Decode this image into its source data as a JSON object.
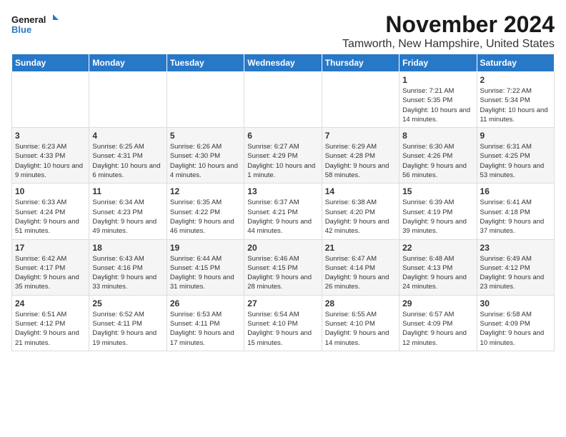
{
  "logo": {
    "line1": "General",
    "line2": "Blue"
  },
  "title": "November 2024",
  "location": "Tamworth, New Hampshire, United States",
  "days_of_week": [
    "Sunday",
    "Monday",
    "Tuesday",
    "Wednesday",
    "Thursday",
    "Friday",
    "Saturday"
  ],
  "weeks": [
    [
      {
        "day": "",
        "info": ""
      },
      {
        "day": "",
        "info": ""
      },
      {
        "day": "",
        "info": ""
      },
      {
        "day": "",
        "info": ""
      },
      {
        "day": "",
        "info": ""
      },
      {
        "day": "1",
        "info": "Sunrise: 7:21 AM\nSunset: 5:35 PM\nDaylight: 10 hours and 14 minutes."
      },
      {
        "day": "2",
        "info": "Sunrise: 7:22 AM\nSunset: 5:34 PM\nDaylight: 10 hours and 11 minutes."
      }
    ],
    [
      {
        "day": "3",
        "info": "Sunrise: 6:23 AM\nSunset: 4:33 PM\nDaylight: 10 hours and 9 minutes."
      },
      {
        "day": "4",
        "info": "Sunrise: 6:25 AM\nSunset: 4:31 PM\nDaylight: 10 hours and 6 minutes."
      },
      {
        "day": "5",
        "info": "Sunrise: 6:26 AM\nSunset: 4:30 PM\nDaylight: 10 hours and 4 minutes."
      },
      {
        "day": "6",
        "info": "Sunrise: 6:27 AM\nSunset: 4:29 PM\nDaylight: 10 hours and 1 minute."
      },
      {
        "day": "7",
        "info": "Sunrise: 6:29 AM\nSunset: 4:28 PM\nDaylight: 9 hours and 58 minutes."
      },
      {
        "day": "8",
        "info": "Sunrise: 6:30 AM\nSunset: 4:26 PM\nDaylight: 9 hours and 56 minutes."
      },
      {
        "day": "9",
        "info": "Sunrise: 6:31 AM\nSunset: 4:25 PM\nDaylight: 9 hours and 53 minutes."
      }
    ],
    [
      {
        "day": "10",
        "info": "Sunrise: 6:33 AM\nSunset: 4:24 PM\nDaylight: 9 hours and 51 minutes."
      },
      {
        "day": "11",
        "info": "Sunrise: 6:34 AM\nSunset: 4:23 PM\nDaylight: 9 hours and 49 minutes."
      },
      {
        "day": "12",
        "info": "Sunrise: 6:35 AM\nSunset: 4:22 PM\nDaylight: 9 hours and 46 minutes."
      },
      {
        "day": "13",
        "info": "Sunrise: 6:37 AM\nSunset: 4:21 PM\nDaylight: 9 hours and 44 minutes."
      },
      {
        "day": "14",
        "info": "Sunrise: 6:38 AM\nSunset: 4:20 PM\nDaylight: 9 hours and 42 minutes."
      },
      {
        "day": "15",
        "info": "Sunrise: 6:39 AM\nSunset: 4:19 PM\nDaylight: 9 hours and 39 minutes."
      },
      {
        "day": "16",
        "info": "Sunrise: 6:41 AM\nSunset: 4:18 PM\nDaylight: 9 hours and 37 minutes."
      }
    ],
    [
      {
        "day": "17",
        "info": "Sunrise: 6:42 AM\nSunset: 4:17 PM\nDaylight: 9 hours and 35 minutes."
      },
      {
        "day": "18",
        "info": "Sunrise: 6:43 AM\nSunset: 4:16 PM\nDaylight: 9 hours and 33 minutes."
      },
      {
        "day": "19",
        "info": "Sunrise: 6:44 AM\nSunset: 4:15 PM\nDaylight: 9 hours and 31 minutes."
      },
      {
        "day": "20",
        "info": "Sunrise: 6:46 AM\nSunset: 4:15 PM\nDaylight: 9 hours and 28 minutes."
      },
      {
        "day": "21",
        "info": "Sunrise: 6:47 AM\nSunset: 4:14 PM\nDaylight: 9 hours and 26 minutes."
      },
      {
        "day": "22",
        "info": "Sunrise: 6:48 AM\nSunset: 4:13 PM\nDaylight: 9 hours and 24 minutes."
      },
      {
        "day": "23",
        "info": "Sunrise: 6:49 AM\nSunset: 4:12 PM\nDaylight: 9 hours and 23 minutes."
      }
    ],
    [
      {
        "day": "24",
        "info": "Sunrise: 6:51 AM\nSunset: 4:12 PM\nDaylight: 9 hours and 21 minutes."
      },
      {
        "day": "25",
        "info": "Sunrise: 6:52 AM\nSunset: 4:11 PM\nDaylight: 9 hours and 19 minutes."
      },
      {
        "day": "26",
        "info": "Sunrise: 6:53 AM\nSunset: 4:11 PM\nDaylight: 9 hours and 17 minutes."
      },
      {
        "day": "27",
        "info": "Sunrise: 6:54 AM\nSunset: 4:10 PM\nDaylight: 9 hours and 15 minutes."
      },
      {
        "day": "28",
        "info": "Sunrise: 6:55 AM\nSunset: 4:10 PM\nDaylight: 9 hours and 14 minutes."
      },
      {
        "day": "29",
        "info": "Sunrise: 6:57 AM\nSunset: 4:09 PM\nDaylight: 9 hours and 12 minutes."
      },
      {
        "day": "30",
        "info": "Sunrise: 6:58 AM\nSunset: 4:09 PM\nDaylight: 9 hours and 10 minutes."
      }
    ]
  ]
}
